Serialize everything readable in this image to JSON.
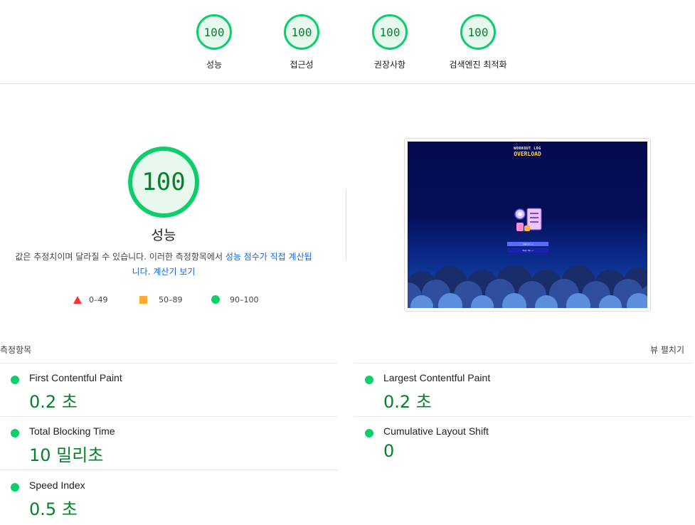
{
  "top_scores": [
    {
      "score": "100",
      "label": "성능"
    },
    {
      "score": "100",
      "label": "접근성"
    },
    {
      "score": "100",
      "label": "권장사항"
    },
    {
      "score": "100",
      "label": "검색엔진 최적화"
    }
  ],
  "performance": {
    "score": "100",
    "title": "성능",
    "desc_text": "값은 추정치이며 달라질 수 있습니다. 이러한 측정항목에서 ",
    "desc_link1": "성능 점수가 직접 계산됩니다.",
    "desc_link2": "계산기 보기"
  },
  "legend": {
    "fail": "0–49",
    "average": "50–89",
    "pass": "90–100"
  },
  "screenshot": {
    "line1": "WORKOUT LOG",
    "line2": "OVERLOAD",
    "btn1": "Sign in →",
    "btn2": "Sign Up →"
  },
  "metrics_section": {
    "label": "측정항목",
    "expand_label": "뷰 펼치기"
  },
  "metrics": [
    {
      "name": "First Contentful Paint",
      "value": "0.2 초"
    },
    {
      "name": "Largest Contentful Paint",
      "value": "0.2 초"
    },
    {
      "name": "Total Blocking Time",
      "value": "10 밀리초"
    },
    {
      "name": "Cumulative Layout Shift",
      "value": "0"
    },
    {
      "name": "Speed Index",
      "value": "0.5 초"
    }
  ],
  "colors": {
    "pass": "#0cce6b",
    "pass_text": "#08802c",
    "average": "#ffaa33",
    "fail": "#ff3333",
    "link": "#1967d2"
  }
}
